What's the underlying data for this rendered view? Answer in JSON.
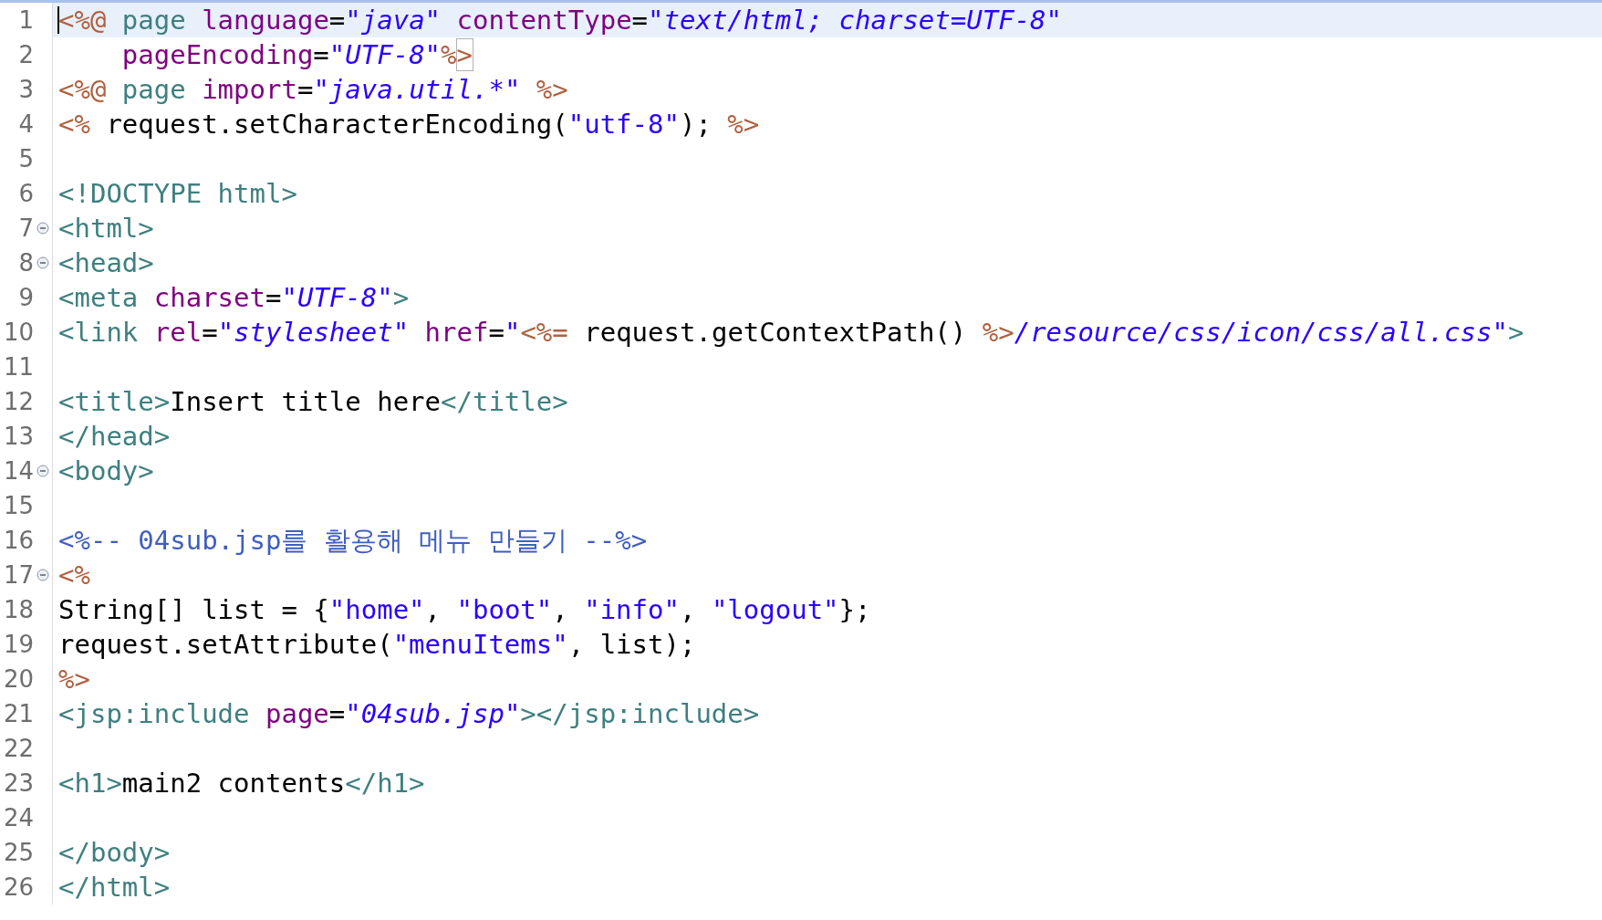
{
  "lines": [
    {
      "number": "1",
      "current": true,
      "tokens": [
        {
          "kind": "jsp",
          "text": "<%@"
        },
        {
          "kind": "tag",
          "text": " page"
        },
        {
          "kind": "attr",
          "text": " language"
        },
        {
          "kind": "text",
          "text": "="
        },
        {
          "kind": "str",
          "text": "\"java\""
        },
        {
          "kind": "attr",
          "text": " contentType"
        },
        {
          "kind": "text",
          "text": "="
        },
        {
          "kind": "str",
          "text": "\"text/html; charset=UTF-8\""
        }
      ]
    },
    {
      "number": "2",
      "current": false,
      "tokens": [
        {
          "kind": "attr",
          "text": "    pageEncoding"
        },
        {
          "kind": "text",
          "text": "="
        },
        {
          "kind": "str",
          "text": "\"UTF-8\""
        },
        {
          "kind": "jsp",
          "text": "%"
        },
        {
          "kind": "jsp",
          "text": ">",
          "matched": true
        }
      ]
    },
    {
      "number": "3",
      "current": false,
      "tokens": [
        {
          "kind": "jsp",
          "text": "<%@"
        },
        {
          "kind": "tag",
          "text": " page"
        },
        {
          "kind": "attr",
          "text": " import"
        },
        {
          "kind": "text",
          "text": "="
        },
        {
          "kind": "str",
          "text": "\"java.util.*\""
        },
        {
          "kind": "jsp",
          "text": " %>"
        }
      ]
    },
    {
      "number": "4",
      "current": false,
      "tokens": [
        {
          "kind": "jsp",
          "text": "<%"
        },
        {
          "kind": "text",
          "text": " request.setCharacterEncoding("
        },
        {
          "kind": "jstr",
          "text": "\"utf-8\""
        },
        {
          "kind": "text",
          "text": ");"
        },
        {
          "kind": "jsp",
          "text": " %>"
        }
      ]
    },
    {
      "number": "5",
      "current": false
    },
    {
      "number": "6",
      "current": false,
      "tokens": [
        {
          "kind": "tag",
          "text": "<!DOCTYPE html>"
        }
      ]
    },
    {
      "number": "7",
      "current": false,
      "fold_expanded": true,
      "tokens": [
        {
          "kind": "tag",
          "text": "<html>"
        }
      ]
    },
    {
      "number": "8",
      "current": false,
      "fold_expanded": true,
      "tokens": [
        {
          "kind": "tag",
          "text": "<head>"
        }
      ]
    },
    {
      "number": "9",
      "current": false,
      "tokens": [
        {
          "kind": "tag",
          "text": "<meta"
        },
        {
          "kind": "attr",
          "text": " charset"
        },
        {
          "kind": "text",
          "text": "="
        },
        {
          "kind": "str",
          "text": "\"UTF-8\""
        },
        {
          "kind": "tag",
          "text": ">"
        }
      ]
    },
    {
      "number": "10",
      "current": false,
      "tokens": [
        {
          "kind": "tag",
          "text": "<link"
        },
        {
          "kind": "attr",
          "text": " rel"
        },
        {
          "kind": "text",
          "text": "="
        },
        {
          "kind": "str",
          "text": "\"stylesheet\""
        },
        {
          "kind": "attr",
          "text": " href"
        },
        {
          "kind": "text",
          "text": "="
        },
        {
          "kind": "str",
          "text": "\""
        },
        {
          "kind": "jsp",
          "text": "<%="
        },
        {
          "kind": "text",
          "text": " request.getContextPath()"
        },
        {
          "kind": "jsp",
          "text": " %>"
        },
        {
          "kind": "str",
          "text": "/resource/css/icon/css/all.css\""
        },
        {
          "kind": "tag",
          "text": ">"
        }
      ]
    },
    {
      "number": "11",
      "current": false
    },
    {
      "number": "12",
      "current": false,
      "tokens": [
        {
          "kind": "tag",
          "text": "<title>"
        },
        {
          "kind": "text",
          "text": "Insert title here"
        },
        {
          "kind": "tag",
          "text": "</title>"
        }
      ]
    },
    {
      "number": "13",
      "current": false,
      "tokens": [
        {
          "kind": "tag",
          "text": "</head>"
        }
      ]
    },
    {
      "number": "14",
      "current": false,
      "fold_expanded": true,
      "tokens": [
        {
          "kind": "tag",
          "text": "<body>"
        }
      ]
    },
    {
      "number": "15",
      "current": false
    },
    {
      "number": "16",
      "current": false,
      "tokens": [
        {
          "kind": "comment",
          "text": "<%-- 04sub.jsp를 활용해 메뉴 만들기 --%>"
        }
      ]
    },
    {
      "number": "17",
      "current": false,
      "fold_expanded": true,
      "tokens": [
        {
          "kind": "jsp",
          "text": "<%"
        }
      ]
    },
    {
      "number": "18",
      "current": false,
      "tokens": [
        {
          "kind": "text",
          "text": "String[] list = {"
        },
        {
          "kind": "jstr",
          "text": "\"home\""
        },
        {
          "kind": "text",
          "text": ", "
        },
        {
          "kind": "jstr",
          "text": "\"boot\""
        },
        {
          "kind": "text",
          "text": ", "
        },
        {
          "kind": "jstr",
          "text": "\"info\""
        },
        {
          "kind": "text",
          "text": ", "
        },
        {
          "kind": "jstr",
          "text": "\"logout\""
        },
        {
          "kind": "text",
          "text": "};"
        }
      ]
    },
    {
      "number": "19",
      "current": false,
      "tokens": [
        {
          "kind": "text",
          "text": "request.setAttribute("
        },
        {
          "kind": "jstr",
          "text": "\"menuItems\""
        },
        {
          "kind": "text",
          "text": ", list);"
        }
      ]
    },
    {
      "number": "20",
      "current": false,
      "tokens": [
        {
          "kind": "jsp",
          "text": "%>"
        }
      ]
    },
    {
      "number": "21",
      "current": false,
      "tokens": [
        {
          "kind": "tag",
          "text": "<jsp:include"
        },
        {
          "kind": "attr",
          "text": " page"
        },
        {
          "kind": "text",
          "text": "="
        },
        {
          "kind": "str",
          "text": "\"04sub.jsp\""
        },
        {
          "kind": "tag",
          "text": "></jsp:include>"
        }
      ]
    },
    {
      "number": "22",
      "current": false
    },
    {
      "number": "23",
      "current": false,
      "tokens": [
        {
          "kind": "tag",
          "text": "<h1>"
        },
        {
          "kind": "text",
          "text": "main2 contents"
        },
        {
          "kind": "tag",
          "text": "</h1>"
        }
      ]
    },
    {
      "number": "24",
      "current": false
    },
    {
      "number": "25",
      "current": false,
      "tokens": [
        {
          "kind": "tag",
          "text": "</body>"
        }
      ]
    },
    {
      "number": "26",
      "current": false,
      "tokens": [
        {
          "kind": "tag",
          "text": "</html>"
        }
      ]
    }
  ]
}
